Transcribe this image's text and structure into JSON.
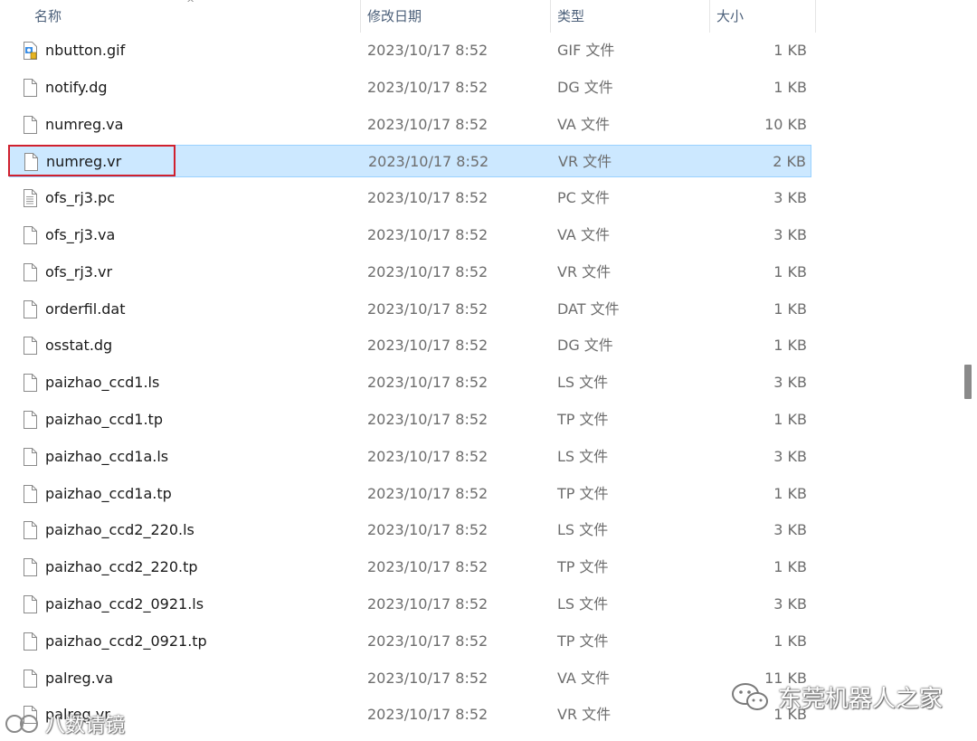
{
  "columns": {
    "name": "名称",
    "modified": "修改日期",
    "type": "类型",
    "size": "大小"
  },
  "files": [
    {
      "name": "nbutton.gif",
      "modified": "2023/10/17 8:52",
      "type": "GIF 文件",
      "size": "1 KB",
      "icon": "gif-image-icon"
    },
    {
      "name": "notify.dg",
      "modified": "2023/10/17 8:52",
      "type": "DG 文件",
      "size": "1 KB",
      "icon": "file-icon"
    },
    {
      "name": "numreg.va",
      "modified": "2023/10/17 8:52",
      "type": "VA 文件",
      "size": "10 KB",
      "icon": "file-icon"
    },
    {
      "name": "numreg.vr",
      "modified": "2023/10/17 8:52",
      "type": "VR 文件",
      "size": "2 KB",
      "icon": "file-icon",
      "selected": true
    },
    {
      "name": "ofs_rj3.pc",
      "modified": "2023/10/17 8:52",
      "type": "PC 文件",
      "size": "3 KB",
      "icon": "text-file-icon"
    },
    {
      "name": "ofs_rj3.va",
      "modified": "2023/10/17 8:52",
      "type": "VA 文件",
      "size": "3 KB",
      "icon": "file-icon"
    },
    {
      "name": "ofs_rj3.vr",
      "modified": "2023/10/17 8:52",
      "type": "VR 文件",
      "size": "1 KB",
      "icon": "file-icon"
    },
    {
      "name": "orderfil.dat",
      "modified": "2023/10/17 8:52",
      "type": "DAT 文件",
      "size": "1 KB",
      "icon": "file-icon"
    },
    {
      "name": "osstat.dg",
      "modified": "2023/10/17 8:52",
      "type": "DG 文件",
      "size": "1 KB",
      "icon": "file-icon"
    },
    {
      "name": "paizhao_ccd1.ls",
      "modified": "2023/10/17 8:52",
      "type": "LS 文件",
      "size": "3 KB",
      "icon": "file-icon"
    },
    {
      "name": "paizhao_ccd1.tp",
      "modified": "2023/10/17 8:52",
      "type": "TP 文件",
      "size": "1 KB",
      "icon": "file-icon"
    },
    {
      "name": "paizhao_ccd1a.ls",
      "modified": "2023/10/17 8:52",
      "type": "LS 文件",
      "size": "3 KB",
      "icon": "file-icon"
    },
    {
      "name": "paizhao_ccd1a.tp",
      "modified": "2023/10/17 8:52",
      "type": "TP 文件",
      "size": "1 KB",
      "icon": "file-icon"
    },
    {
      "name": "paizhao_ccd2_220.ls",
      "modified": "2023/10/17 8:52",
      "type": "LS 文件",
      "size": "3 KB",
      "icon": "file-icon"
    },
    {
      "name": "paizhao_ccd2_220.tp",
      "modified": "2023/10/17 8:52",
      "type": "TP 文件",
      "size": "1 KB",
      "icon": "file-icon"
    },
    {
      "name": "paizhao_ccd2_0921.ls",
      "modified": "2023/10/17 8:52",
      "type": "LS 文件",
      "size": "3 KB",
      "icon": "file-icon"
    },
    {
      "name": "paizhao_ccd2_0921.tp",
      "modified": "2023/10/17 8:52",
      "type": "TP 文件",
      "size": "1 KB",
      "icon": "file-icon"
    },
    {
      "name": "palreg.va",
      "modified": "2023/10/17 8:52",
      "type": "VA 文件",
      "size": "11 KB",
      "icon": "file-icon"
    },
    {
      "name": "palreg.vr",
      "modified": "2023/10/17 8:52",
      "type": "VR 文件",
      "size": "1 KB",
      "icon": "file-icon"
    }
  ],
  "watermarks": {
    "right": "东莞机器人之家",
    "left": "八数请镜"
  },
  "colors": {
    "selection": "#cce8ff",
    "highlight_box": "#d0202e"
  }
}
